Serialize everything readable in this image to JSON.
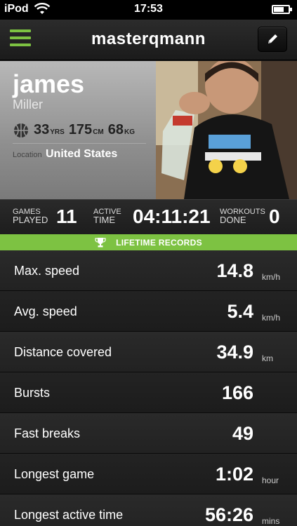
{
  "status_bar": {
    "carrier": "iPod",
    "time": "17:53"
  },
  "nav": {
    "title": "masterqmann",
    "menu_icon": "hamburger-menu-icon",
    "edit_icon": "pencil-icon"
  },
  "profile": {
    "first_name": "james",
    "last_name": "Miller",
    "age": "33",
    "age_unit": "YRS",
    "height": "175",
    "height_unit": "CM",
    "weight": "68",
    "weight_unit": "KG",
    "location_label": "Location",
    "location": "United States"
  },
  "summary": {
    "games_label_1": "GAMES",
    "games_label_2": "PLAYED",
    "games_value": "11",
    "active_label_1": "ACTIVE",
    "active_label_2": "TIME",
    "active_value": "04:11:21",
    "workouts_label_1": "WORKOUTS",
    "workouts_label_2": "DONE",
    "workouts_value": "0"
  },
  "records_header": "LIFETIME RECORDS",
  "records": [
    {
      "label": "Max. speed",
      "value": "14.8",
      "unit": "km/h"
    },
    {
      "label": "Avg. speed",
      "value": "5.4",
      "unit": "km/h"
    },
    {
      "label": "Distance covered",
      "value": "34.9",
      "unit": "km"
    },
    {
      "label": "Bursts",
      "value": "166",
      "unit": ""
    },
    {
      "label": "Fast breaks",
      "value": "49",
      "unit": ""
    },
    {
      "label": "Longest game",
      "value": "1:02",
      "unit": "hour"
    },
    {
      "label": "Longest active time",
      "value": "56:26",
      "unit": "mins"
    }
  ],
  "colors": {
    "accent": "#7dc242",
    "background": "#141414"
  }
}
